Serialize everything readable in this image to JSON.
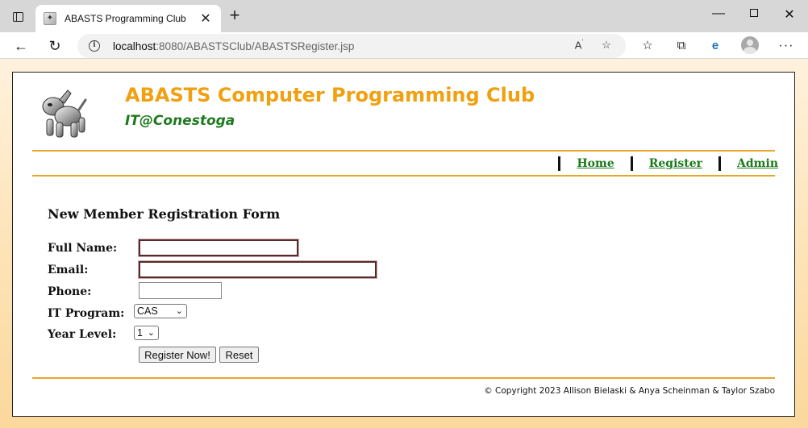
{
  "browser": {
    "tab_title": "ABASTS Programming Club",
    "url_host": "localhost",
    "url_rest": ":8080/ABASTSClub/ABASTSRegister.jsp"
  },
  "site": {
    "title": "ABASTS Computer Programming Club",
    "subtitle": "IT@Conestoga",
    "title_color": "#f0a010",
    "subtitle_color": "#1f7a1f",
    "rule_color": "#e8a628"
  },
  "nav": {
    "items": [
      {
        "label": "Home"
      },
      {
        "label": "Register"
      },
      {
        "label": "Admin"
      }
    ]
  },
  "form": {
    "title": "New Member Registration Form",
    "full_name_label": "Full Name:",
    "full_name_value": "",
    "email_label": "Email:",
    "email_value": "",
    "phone_label": "Phone:",
    "phone_value": "",
    "program_label": "IT Program:",
    "program_selected": "CAS",
    "year_label": "Year Level:",
    "year_selected": "1",
    "register_button": "Register Now!",
    "reset_button": "Reset"
  },
  "footer": {
    "copyright": "© Copyright 2023 Allison Bielaski & Anya Scheinman & Taylor Szabo"
  }
}
